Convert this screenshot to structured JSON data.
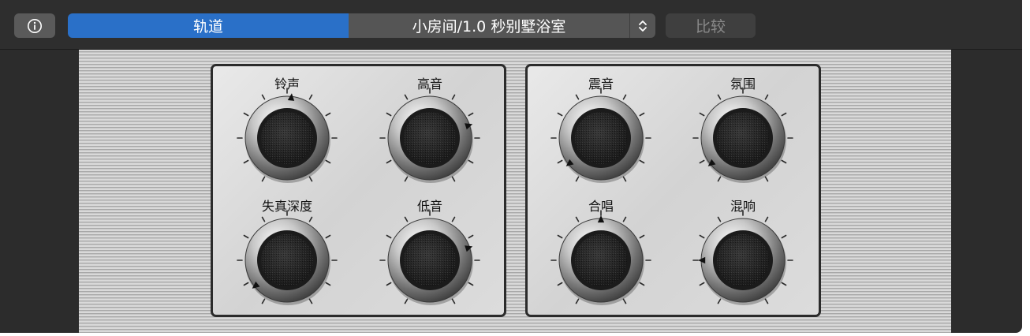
{
  "toolbar": {
    "info_icon": "info-circle-icon",
    "track_tab_label": "轨道",
    "preset_name": "小房间/1.0 秒别墅浴室",
    "stepper_icon": "up-down-chevron-icon",
    "compare_label": "比较"
  },
  "colors": {
    "toolbar_bg": "#2e2e2e",
    "active_segment": "#2a70c8",
    "inactive_segment": "#555555",
    "box_border": "#2b2b2b"
  },
  "knobs": [
    {
      "id": "bells",
      "label": "铃声",
      "value": 0.52,
      "group": "left"
    },
    {
      "id": "treble",
      "label": "高音",
      "value": 0.74,
      "group": "left"
    },
    {
      "id": "drive",
      "label": "失真深度",
      "value": 0.07,
      "group": "left"
    },
    {
      "id": "bass",
      "label": "低音",
      "value": 0.74,
      "group": "left"
    },
    {
      "id": "tremolo",
      "label": "震音",
      "value": 0.07,
      "group": "right"
    },
    {
      "id": "ambience",
      "label": "氛围",
      "value": 0.07,
      "group": "right"
    },
    {
      "id": "chorus",
      "label": "合唱",
      "value": 0.5,
      "group": "right"
    },
    {
      "id": "reverb",
      "label": "混响",
      "value": 0.2,
      "group": "right"
    }
  ]
}
